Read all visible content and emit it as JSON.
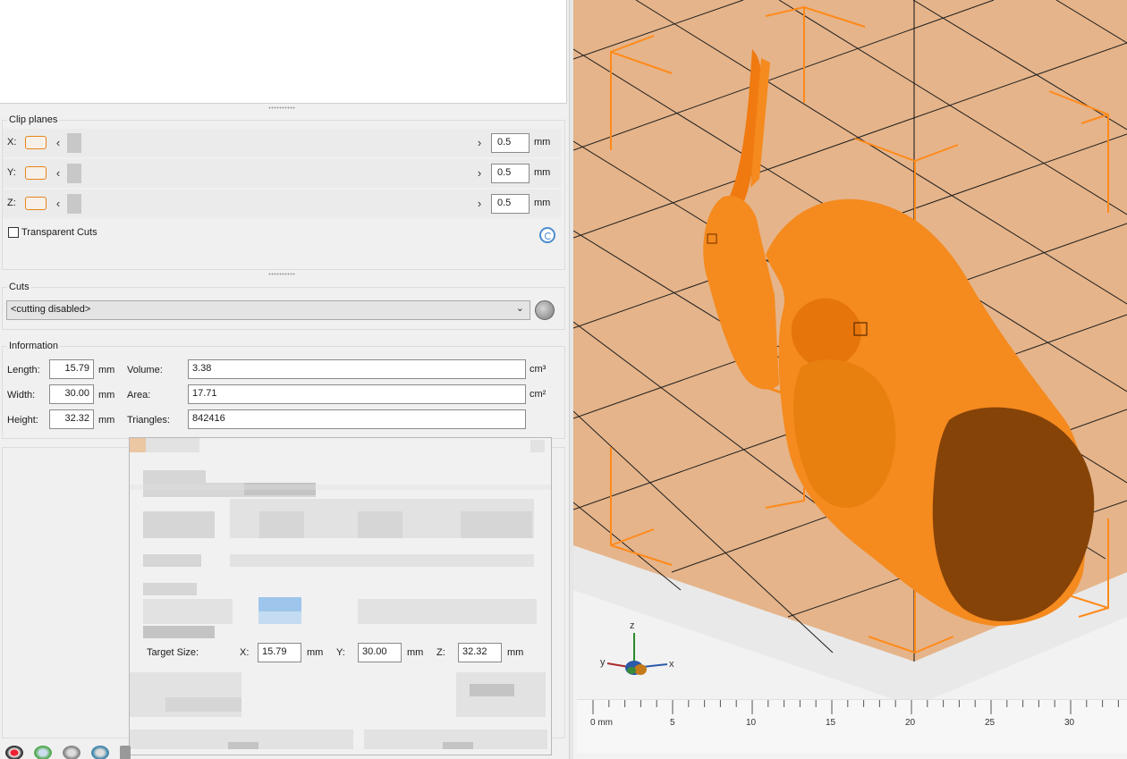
{
  "clip_planes": {
    "title": "Clip planes",
    "rows": [
      {
        "axis": "X:",
        "value": "0.5",
        "unit": "mm"
      },
      {
        "axis": "Y:",
        "value": "0.5",
        "unit": "mm"
      },
      {
        "axis": "Z:",
        "value": "0.5",
        "unit": "mm"
      }
    ],
    "transparent_cuts_label": "Transparent Cuts",
    "transparent_cuts_checked": false
  },
  "cuts": {
    "title": "Cuts",
    "selected": "<cutting disabled>"
  },
  "information": {
    "title": "Information",
    "length_label": "Length:",
    "length_value": "15.79",
    "length_unit": "mm",
    "width_label": "Width:",
    "width_value": "30.00",
    "width_unit": "mm",
    "height_label": "Height:",
    "height_value": "32.32",
    "height_unit": "mm",
    "volume_label": "Volume:",
    "volume_value": "3.38",
    "volume_unit": "cm³",
    "area_label": "Area:",
    "area_value": "17.71",
    "area_unit": "cm²",
    "triangles_label": "Triangles:",
    "triangles_value": "842416"
  },
  "dialog": {
    "target_size_label": "Target Size:",
    "x_label": "X:",
    "x_value": "15.79",
    "x_unit": "mm",
    "y_label": "Y:",
    "y_value": "30.00",
    "y_unit": "mm",
    "z_label": "Z:",
    "z_value": "32.32",
    "z_unit": "mm"
  },
  "viewport": {
    "axes": {
      "x": "x",
      "y": "y",
      "z": "z"
    },
    "ruler_labels": [
      "0 mm",
      "5",
      "10",
      "15",
      "20",
      "25",
      "30"
    ],
    "colors": {
      "bed": "#e5b48a",
      "model": "#f58a1e",
      "cut_face": "#8a4a0e",
      "bbox": "#ff8a1a"
    }
  },
  "icons": [
    "reset-icon",
    "cuts-tool-icon",
    "chevron-down-icon",
    "chevron-left-icon",
    "chevron-right-icon"
  ]
}
